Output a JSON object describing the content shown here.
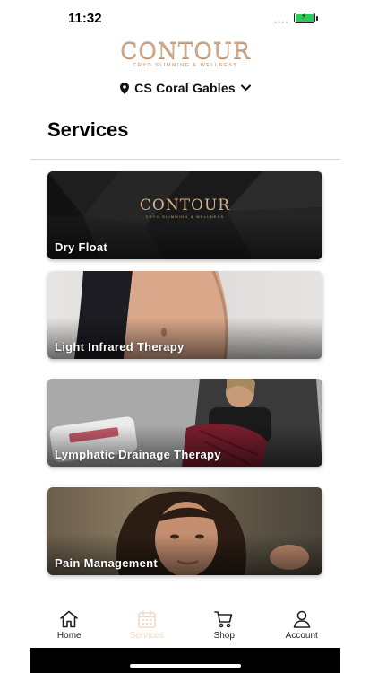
{
  "status_bar": {
    "time": "11:32",
    "signal": "••••",
    "battery_color": "#34c759"
  },
  "logo": {
    "word": "CONTOUR",
    "subtitle": "CRYO SLIMMING & WELLNESS"
  },
  "location": {
    "icon": "map-pin-icon",
    "label": "CS Coral Gables",
    "chevron": "chevron-down-icon"
  },
  "page": {
    "title": "Services"
  },
  "services": [
    {
      "label": "Dry Float",
      "logo_word": "CONTOUR",
      "logo_sub": "CRYO SLIMMING & WELLNESS"
    },
    {
      "label": "Light Infrared Therapy"
    },
    {
      "label": "Lymphatic Drainage Therapy"
    },
    {
      "label": "Pain Management"
    }
  ],
  "tab_bar": {
    "active_color": "#f0d9c4",
    "tabs": [
      {
        "label": "Home",
        "icon": "home-icon"
      },
      {
        "label": "Services",
        "icon": "calendar-icon"
      },
      {
        "label": "Shop",
        "icon": "cart-icon"
      },
      {
        "label": "Account",
        "icon": "user-icon"
      }
    ]
  },
  "colors": {
    "accent": "#cfa988",
    "text": "#111111"
  }
}
